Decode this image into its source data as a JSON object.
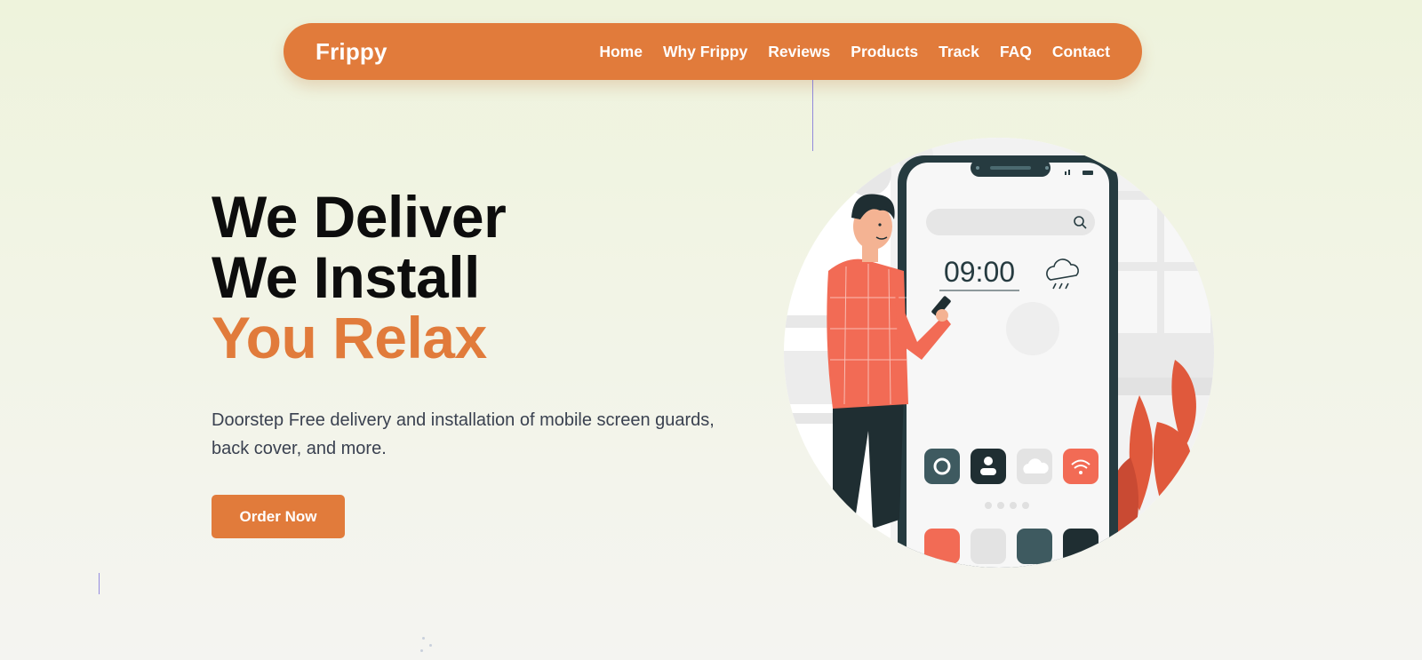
{
  "nav": {
    "logo": "Frippy",
    "items": [
      {
        "label": "Home"
      },
      {
        "label": "Why Frippy"
      },
      {
        "label": "Reviews"
      },
      {
        "label": "Products"
      },
      {
        "label": "Track"
      },
      {
        "label": "FAQ"
      },
      {
        "label": "Contact"
      }
    ]
  },
  "hero": {
    "line1": "We Deliver",
    "line2": "We Install",
    "line3": "You Relax",
    "description": "Doorstep Free delivery and installation of mobile screen guards, back cover, and more.",
    "cta_label": "Order Now"
  },
  "illustration": {
    "clock": "09:00",
    "icons": [
      "gear-icon",
      "user-icon",
      "cloud-icon",
      "wifi-icon",
      "phone-icon",
      "search-icon",
      "whatsapp-icon",
      "rain-cloud-icon"
    ]
  },
  "colors": {
    "accent": "#e17b3b",
    "text_dark": "#0d0d0d",
    "phone_dark": "#263b40",
    "shirt": "#f26b55"
  }
}
